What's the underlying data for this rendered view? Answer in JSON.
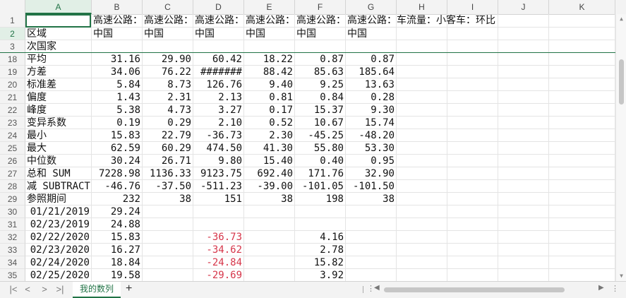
{
  "columns": [
    "A",
    "B",
    "C",
    "D",
    "E",
    "F",
    "G",
    "H",
    "I",
    "J",
    "K"
  ],
  "selected_column": "A",
  "rows": [
    {
      "num": "1",
      "cells": [
        "",
        "高速公路：中国",
        "高速公路：中国",
        "高速公路：中国",
        "高速公路：中国",
        "高速公路：中国",
        "高速公路：车流量：小客车：环比",
        "",
        "",
        "",
        ""
      ]
    },
    {
      "num": "2",
      "cells": [
        "区域",
        "中国",
        "中国",
        "中国",
        "中国",
        "中国",
        "中国",
        "",
        "",
        "",
        ""
      ]
    },
    {
      "num": "3",
      "cells": [
        "次国家",
        "",
        "",
        "",
        "",
        "",
        "",
        "",
        "",
        "",
        ""
      ]
    },
    {
      "num": "18",
      "cells": [
        "平均",
        "31.16",
        "29.90",
        "60.42",
        "18.22",
        "0.87",
        "0.87",
        "",
        "",
        "",
        ""
      ]
    },
    {
      "num": "19",
      "cells": [
        "方差",
        "34.06",
        "76.22",
        "#######",
        "88.42",
        "85.63",
        "185.64",
        "",
        "",
        "",
        ""
      ]
    },
    {
      "num": "20",
      "cells": [
        "标准差",
        "5.84",
        "8.73",
        "126.76",
        "9.40",
        "9.25",
        "13.63",
        "",
        "",
        "",
        ""
      ]
    },
    {
      "num": "21",
      "cells": [
        "偏度",
        "1.43",
        "2.31",
        "2.13",
        "0.81",
        "0.84",
        "0.28",
        "",
        "",
        "",
        ""
      ]
    },
    {
      "num": "22",
      "cells": [
        "峰度",
        "5.38",
        "4.73",
        "3.27",
        "0.17",
        "15.37",
        "9.30",
        "",
        "",
        "",
        ""
      ]
    },
    {
      "num": "23",
      "cells": [
        "变异系数",
        "0.19",
        "0.29",
        "2.10",
        "0.52",
        "10.67",
        "15.74",
        "",
        "",
        "",
        ""
      ]
    },
    {
      "num": "24",
      "cells": [
        "最小",
        "15.83",
        "22.79",
        "-36.73",
        "2.30",
        "-45.25",
        "-48.20",
        "",
        "",
        "",
        ""
      ]
    },
    {
      "num": "25",
      "cells": [
        "最大",
        "62.59",
        "60.29",
        "474.50",
        "41.30",
        "55.80",
        "53.30",
        "",
        "",
        "",
        ""
      ]
    },
    {
      "num": "26",
      "cells": [
        "中位数",
        "30.24",
        "26.71",
        "9.80",
        "15.40",
        "0.40",
        "0.95",
        "",
        "",
        "",
        ""
      ]
    },
    {
      "num": "27",
      "cells": [
        "总和 SUM",
        "7228.98",
        "1136.33",
        "9123.75",
        "692.40",
        "171.76",
        "32.90",
        "",
        "",
        "",
        ""
      ]
    },
    {
      "num": "28",
      "cells": [
        "减 SUBTRACT",
        "-46.76",
        "-37.50",
        "-511.23",
        "-39.00",
        "-101.05",
        "-101.50",
        "",
        "",
        "",
        ""
      ]
    },
    {
      "num": "29",
      "cells": [
        "参照期间",
        "232",
        "38",
        "151",
        "38",
        "198",
        "38",
        "",
        "",
        "",
        ""
      ]
    },
    {
      "num": "30",
      "cells": [
        "01/21/2019",
        "29.24",
        "",
        "",
        "",
        "",
        "",
        "",
        "",
        "",
        ""
      ]
    },
    {
      "num": "31",
      "cells": [
        "02/23/2019",
        "24.88",
        "",
        "",
        "",
        "",
        "",
        "",
        "",
        "",
        ""
      ]
    },
    {
      "num": "32",
      "cells": [
        "02/22/2020",
        "15.83",
        "",
        "-36.73",
        "",
        "4.16",
        "",
        "",
        "",
        "",
        ""
      ]
    },
    {
      "num": "33",
      "cells": [
        "02/23/2020",
        "16.27",
        "",
        "-34.62",
        "",
        "2.78",
        "",
        "",
        "",
        "",
        ""
      ]
    },
    {
      "num": "34",
      "cells": [
        "02/24/2020",
        "18.84",
        "",
        "-24.84",
        "",
        "15.82",
        "",
        "",
        "",
        "",
        ""
      ]
    },
    {
      "num": "35",
      "cells": [
        "02/25/2020",
        "19.58",
        "",
        "-29.69",
        "",
        "3.92",
        "",
        "",
        "",
        "",
        ""
      ]
    }
  ],
  "sheet_tab": "我的数列",
  "add_sheet": "+",
  "nav_arrows": [
    "|<",
    "<",
    ">",
    ">|"
  ],
  "colors": {
    "accent": "#217346",
    "negative": "#d6364a"
  }
}
